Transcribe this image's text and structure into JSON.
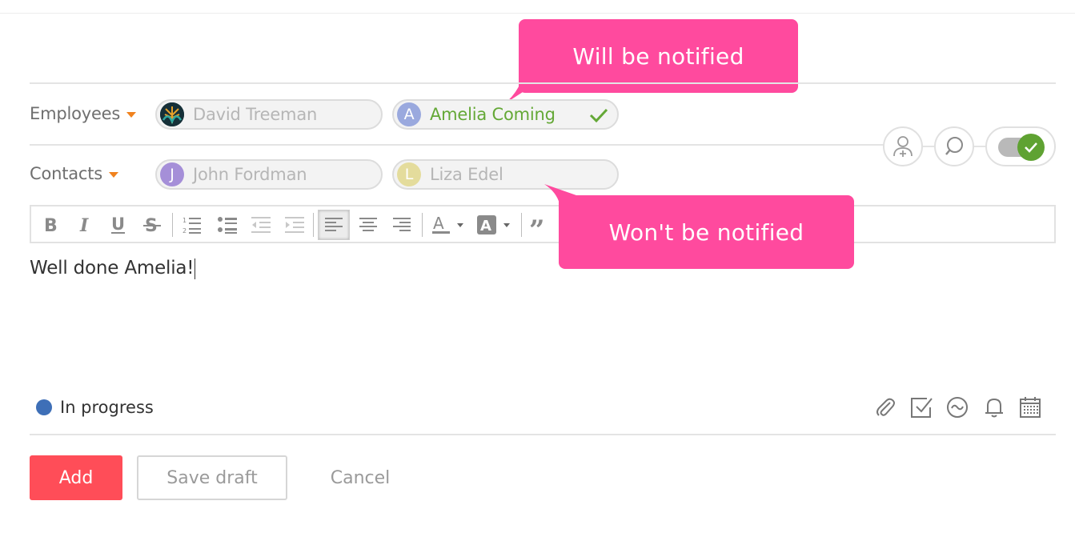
{
  "form": {
    "employees_label": "Employees",
    "contacts_label": "Contacts",
    "employees": [
      {
        "name": "David Treeman",
        "initial": ""
      },
      {
        "name": "Amelia Coming",
        "initial": "A"
      }
    ],
    "contacts": [
      {
        "name": "John Fordman",
        "initial": "J"
      },
      {
        "name": "Liza Edel",
        "initial": "L"
      }
    ]
  },
  "tooltips": {
    "notified": "Will be notified",
    "not_notified": "Won't be notified"
  },
  "editor": {
    "text": "Well done Amelia!"
  },
  "status": {
    "label": "In progress",
    "color": "#3e6fb7"
  },
  "actions": {
    "add": "Add",
    "save_draft": "Save draft",
    "cancel": "Cancel"
  },
  "colors": {
    "accent_pink": "#ff4a9e",
    "add_button": "#ff4d58",
    "notified_green": "#64a836",
    "dropdown_orange": "#f0821e"
  },
  "toolbar_icons": [
    "bold-icon",
    "italic-icon",
    "underline-icon",
    "strikethrough-icon",
    "ordered-list-icon",
    "bullet-list-icon",
    "outdent-icon",
    "indent-icon",
    "align-left-icon",
    "align-center-icon",
    "align-right-icon",
    "text-color-icon",
    "highlight-color-icon",
    "quote-icon"
  ],
  "footer_icons": [
    "paperclip-icon",
    "checkbox-icon",
    "wave-icon",
    "bell-icon",
    "calendar-icon"
  ]
}
